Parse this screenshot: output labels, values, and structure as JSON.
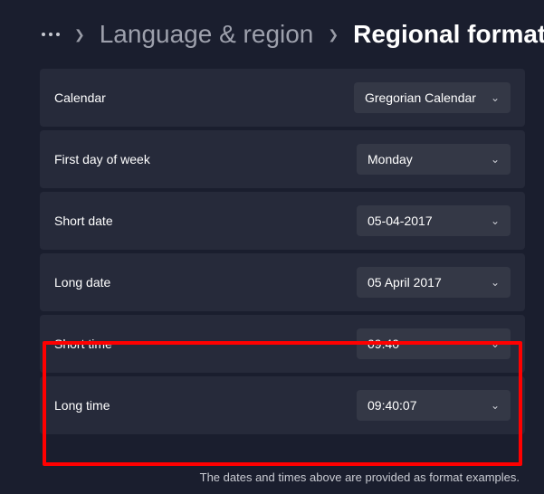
{
  "breadcrumb": {
    "prev": "Language & region",
    "current": "Regional format"
  },
  "rows": {
    "calendar": {
      "label": "Calendar",
      "value": "Gregorian Calendar"
    },
    "firstday": {
      "label": "First day of week",
      "value": "Monday"
    },
    "shortdate": {
      "label": "Short date",
      "value": "05-04-2017"
    },
    "longdate": {
      "label": "Long date",
      "value": "05 April 2017"
    },
    "shorttime": {
      "label": "Short time",
      "value": "09:40"
    },
    "longtime": {
      "label": "Long time",
      "value": "09:40:07"
    }
  },
  "footer": "The dates and times above are provided as format examples."
}
